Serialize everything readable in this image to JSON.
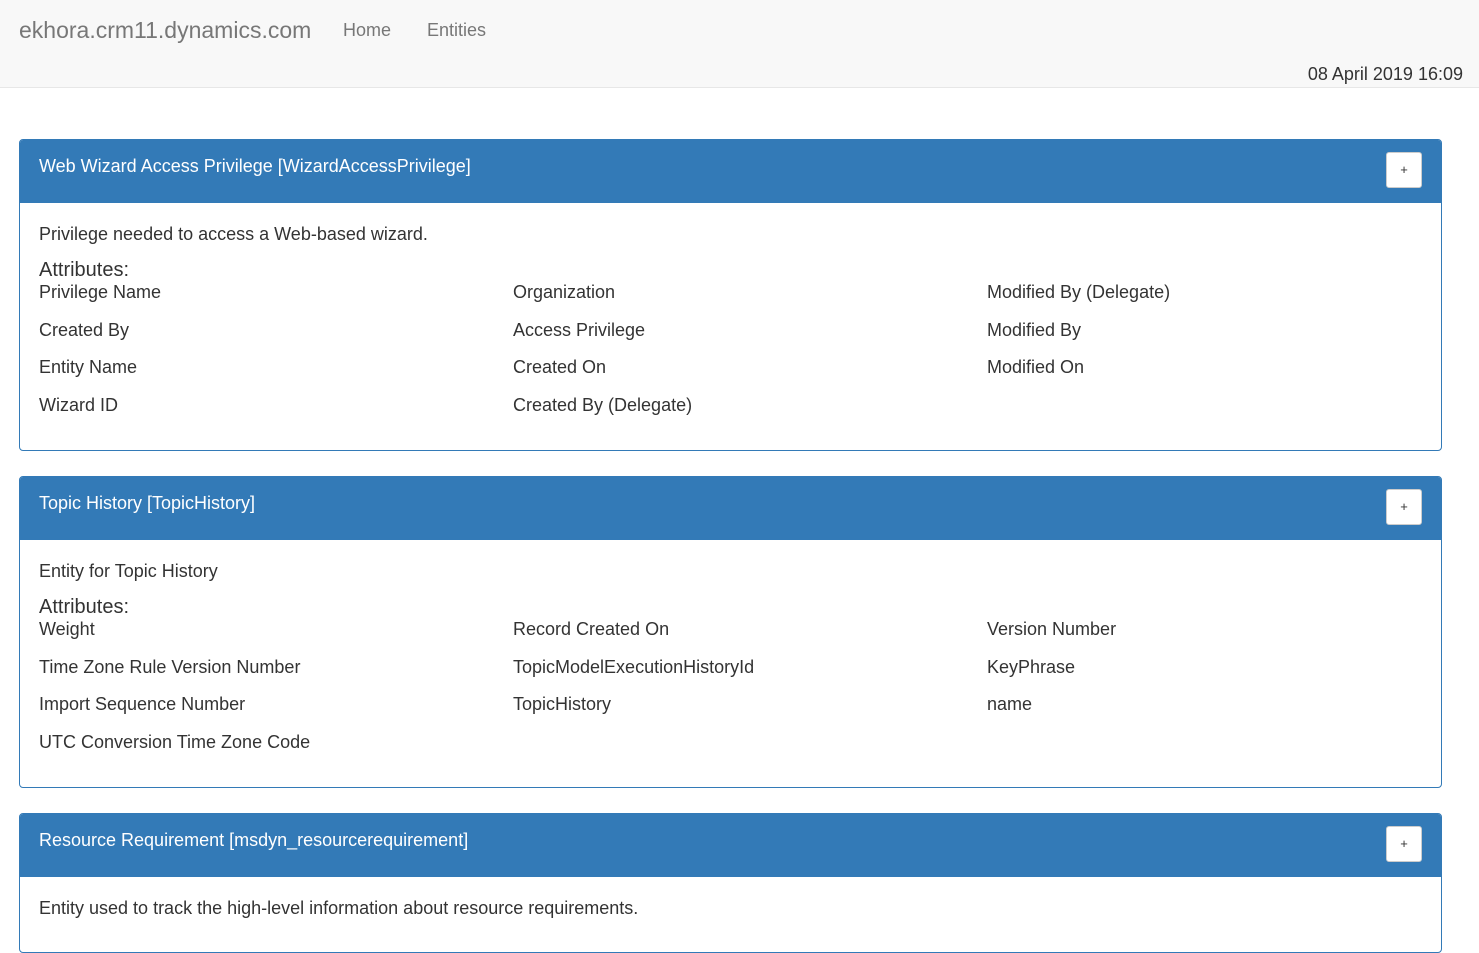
{
  "navbar": {
    "brand": "ekhora.crm11.dynamics.com",
    "links": [
      {
        "label": "Home"
      },
      {
        "label": "Entities"
      }
    ],
    "timestamp": "08 April 2019 16:09"
  },
  "panels": [
    {
      "title": "Web Wizard Access Privilege [WizardAccessPrivilege]",
      "expand_label": "+",
      "description": "Privilege needed to access a Web-based wizard.",
      "attributes_label": "Attributes:",
      "attributes": [
        "Privilege Name",
        "Organization",
        "Modified By (Delegate)",
        "Created By",
        "Access Privilege",
        "Modified By",
        "Entity Name",
        "Created On",
        "Modified On",
        "Wizard ID",
        "Created By (Delegate)"
      ]
    },
    {
      "title": "Topic History [TopicHistory]",
      "expand_label": "+",
      "description": "Entity for Topic History",
      "attributes_label": "Attributes:",
      "attributes": [
        "Weight",
        "Record Created On",
        "Version Number",
        "Time Zone Rule Version Number",
        "TopicModelExecutionHistoryId",
        "KeyPhrase",
        "Import Sequence Number",
        "TopicHistory",
        "name",
        "UTC Conversion Time Zone Code"
      ]
    },
    {
      "title": "Resource Requirement [msdyn_resourcerequirement]",
      "expand_label": "+",
      "description": "Entity used to track the high-level information about resource requirements."
    }
  ],
  "colors": {
    "primary": "#337ab7",
    "navbar_bg": "#f8f8f8",
    "nav_text": "#777777"
  }
}
